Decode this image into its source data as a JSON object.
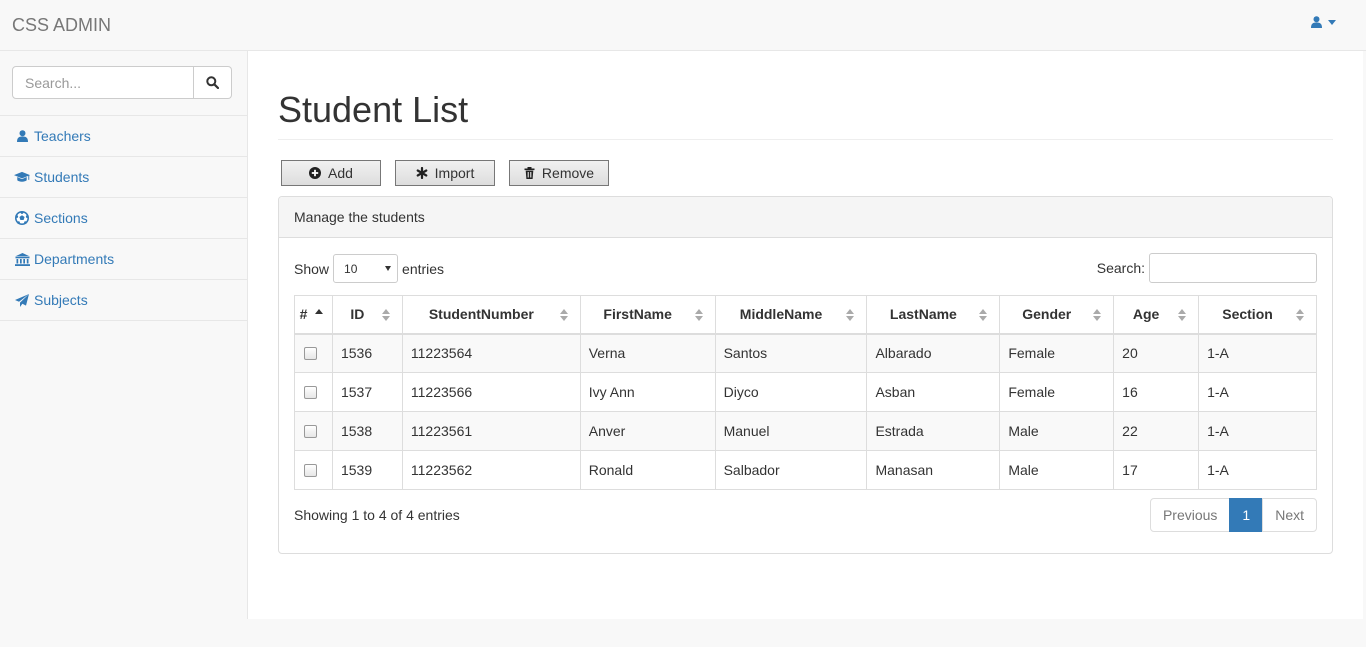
{
  "app": {
    "brand": "CSS ADMIN",
    "user_icon": "user-icon"
  },
  "sidebar": {
    "search": {
      "placeholder": "Search..."
    },
    "items": [
      {
        "label": "Teachers",
        "icon": "user-icon"
      },
      {
        "label": "Students",
        "icon": "graduation-cap-icon"
      },
      {
        "label": "Sections",
        "icon": "soccer-ball-icon"
      },
      {
        "label": "Departments",
        "icon": "institution-icon"
      },
      {
        "label": "Subjects",
        "icon": "paper-plane-icon"
      }
    ]
  },
  "page": {
    "title": "Student List"
  },
  "toolbar": {
    "add_label": "Add",
    "import_label": "Import",
    "remove_label": "Remove"
  },
  "panel": {
    "heading": "Manage the students",
    "show_label": "Show",
    "entries_label": "entries",
    "page_length": "10",
    "search_label": "Search:",
    "search_value": ""
  },
  "table": {
    "columns": [
      "#",
      "ID",
      "StudentNumber",
      "FirstName",
      "MiddleName",
      "LastName",
      "Gender",
      "Age",
      "Section"
    ],
    "rows": [
      {
        "id": "1536",
        "number": "11223564",
        "first": "Verna",
        "middle": "Santos",
        "last": "Albarado",
        "gender": "Female",
        "age": "20",
        "section": "1-A"
      },
      {
        "id": "1537",
        "number": "11223566",
        "first": "Ivy Ann",
        "middle": "Diyco",
        "last": "Asban",
        "gender": "Female",
        "age": "16",
        "section": "1-A"
      },
      {
        "id": "1538",
        "number": "11223561",
        "first": "Anver",
        "middle": "Manuel",
        "last": "Estrada",
        "gender": "Male",
        "age": "22",
        "section": "1-A"
      },
      {
        "id": "1539",
        "number": "11223562",
        "first": "Ronald",
        "middle": "Salbador",
        "last": "Manasan",
        "gender": "Male",
        "age": "17",
        "section": "1-A"
      }
    ]
  },
  "footer": {
    "info": "Showing 1 to 4 of 4 entries",
    "previous": "Previous",
    "current_page": "1",
    "next": "Next"
  },
  "colors": {
    "link": "#337ab7",
    "active_page": "#337ab7"
  }
}
